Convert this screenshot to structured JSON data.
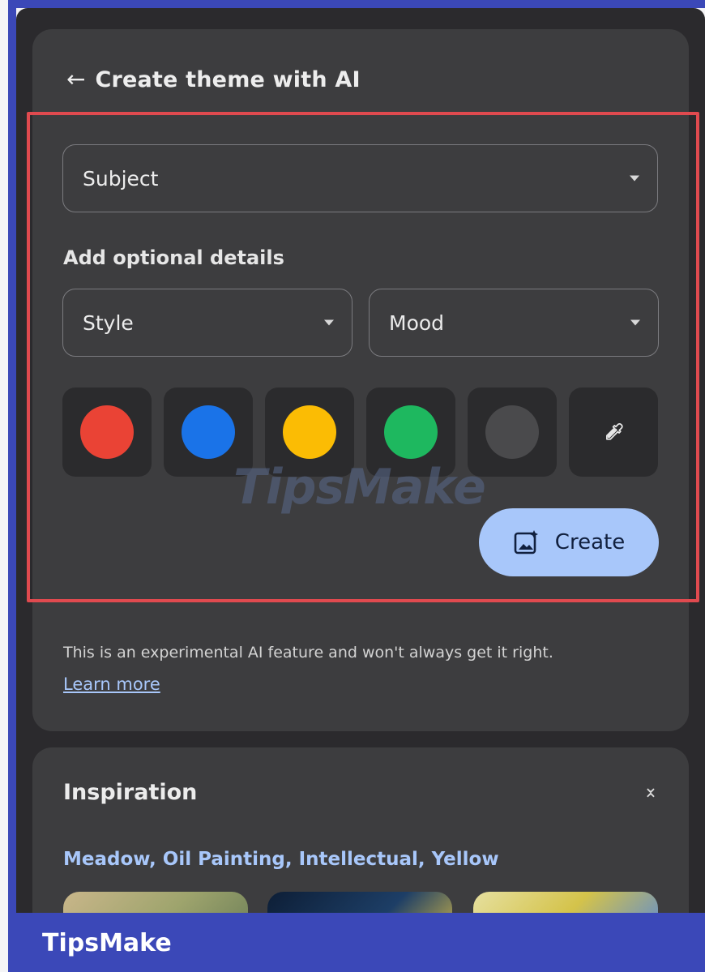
{
  "header": {
    "back_icon": "arrow-left-icon",
    "title": "Create theme with AI"
  },
  "form": {
    "subject_label": "Subject",
    "optional_label": "Add optional details",
    "style_label": "Style",
    "mood_label": "Mood",
    "colors": [
      "#ea4335",
      "#1a73e8",
      "#fbbc04",
      "#1eb85f",
      "#4a4a4c"
    ],
    "eyedropper_icon": "eyedropper-icon",
    "create_label": "Create"
  },
  "disclaimer": {
    "text": "This is an experimental AI feature and won't always get it right.",
    "link": "Learn more"
  },
  "inspiration": {
    "title": "Inspiration",
    "prompt": "Meadow, Oil Painting, Intellectual, Yellow"
  },
  "watermark": "TipsMake",
  "footer": {
    "brand": "TipsMake"
  }
}
